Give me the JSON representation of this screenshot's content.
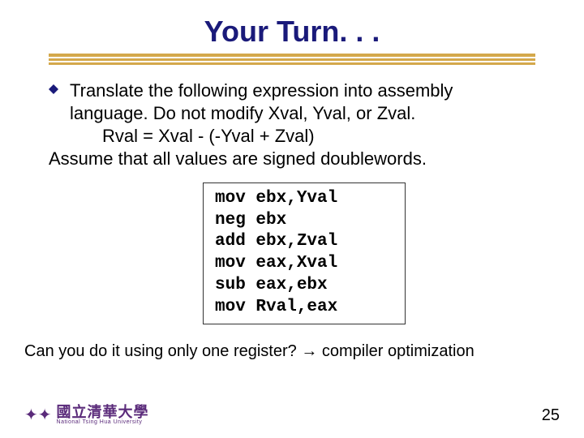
{
  "title": "Your Turn. . .",
  "body": {
    "line1": "Translate the following expression into assembly",
    "line2": "language. Do not modify Xval, Yval, or Zval.",
    "expr": "Rval = Xval - (-Yval + Zval)",
    "line3": "Assume that all values are signed doublewords."
  },
  "code": {
    "l1": "mov ebx,Yval",
    "l2": "neg ebx",
    "l3": "add ebx,Zval",
    "l4": "mov eax,Xval",
    "l5": "sub eax,ebx",
    "l6": "mov Rval,eax"
  },
  "footnote": "Can you do it using only one register? → compiler optimization",
  "footer": {
    "logo_cn": "國立清華大學",
    "logo_en": "National Tsing Hua University",
    "page": "25"
  }
}
